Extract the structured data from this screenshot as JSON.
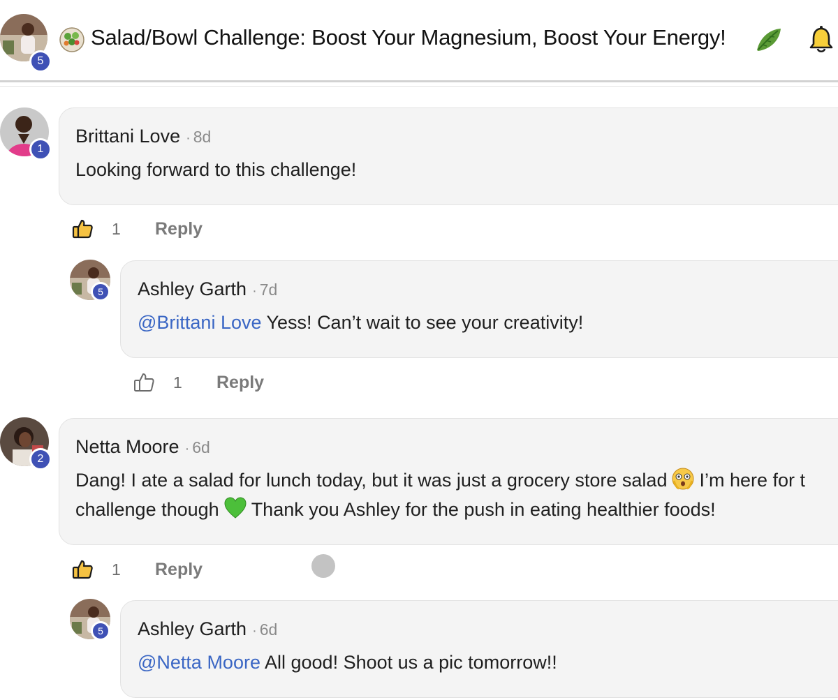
{
  "header": {
    "title": "Salad/Bowl Challenge: Boost Your Magnesium, Boost Your Energy!",
    "avatar_badge": "5",
    "title_icon": "salad-bowl-icon",
    "trailing_icon": "leafy-green-icon",
    "notification_icon": "bell-icon"
  },
  "comments": [
    {
      "author": "Brittani Love",
      "time": "8d",
      "badge": "1",
      "text": "Looking forward to this challenge!",
      "likes": "1",
      "reply_label": "Reply",
      "reply": {
        "author": "Ashley Garth",
        "time": "7d",
        "badge": "5",
        "mention": "@Brittani Love",
        "text": " Yess! Can’t wait to see your creativity!",
        "likes": "1",
        "reply_label": "Reply"
      }
    },
    {
      "author": "Netta Moore",
      "time": "6d",
      "badge": "2",
      "text_line1_a": "Dang! I ate a salad for lunch today, but it was just a grocery store salad",
      "text_line1_b": "I’m here for t",
      "text_line2_a": "challenge though",
      "text_line2_b": "Thank you Ashley for the push in eating healthier foods!",
      "likes": "1",
      "reply_label": "Reply",
      "reply": {
        "author": "Ashley Garth",
        "time": "6d",
        "badge": "5",
        "mention": "@Netta Moore",
        "text": " All good! Shoot us a pic tomorrow!!"
      }
    }
  ],
  "colors": {
    "badge": "#3f51b5",
    "mention": "#3a66c4",
    "bubble": "#f4f4f4",
    "like_active": "#f5c242"
  }
}
